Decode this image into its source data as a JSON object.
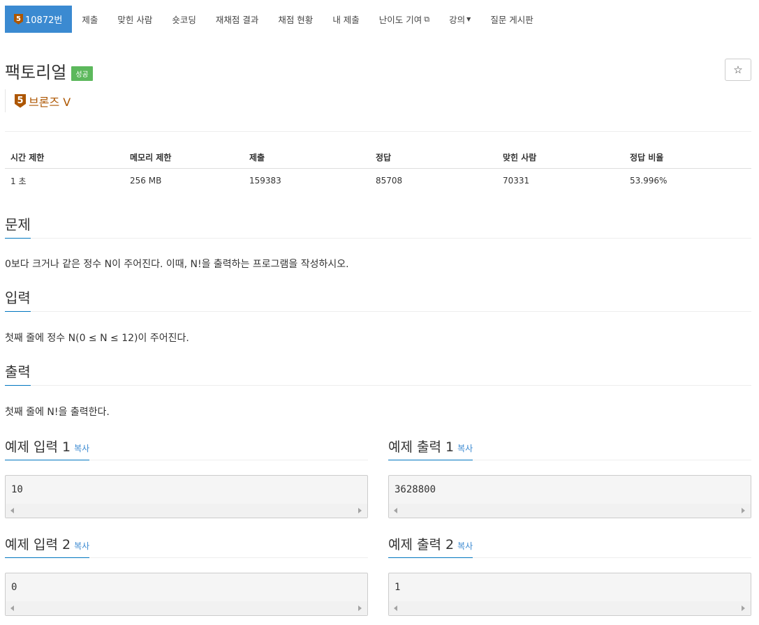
{
  "nav": {
    "problem_tab": "10872번",
    "tier_digit": "5",
    "items": [
      "제출",
      "맞힌 사람",
      "숏코딩",
      "재채점 결과",
      "채점 현황",
      "내 제출",
      "난이도 기여",
      "강의",
      "질문 게시판"
    ]
  },
  "problem": {
    "title": "팩토리얼",
    "status_label": "성공",
    "star_icon": "☆",
    "tier_digit": "5",
    "tier_name": "브론즈 V"
  },
  "info": {
    "headers": [
      "시간 제한",
      "메모리 제한",
      "제출",
      "정답",
      "맞힌 사람",
      "정답 비율"
    ],
    "values": [
      "1 초",
      "256 MB",
      "159383",
      "85708",
      "70331",
      "53.996%"
    ]
  },
  "sections": {
    "description_title": "문제",
    "description_text": "0보다 크거나 같은 정수 N이 주어진다. 이때, N!을 출력하는 프로그램을 작성하시오.",
    "input_title": "입력",
    "input_text": "첫째 줄에 정수 N(0 ≤ N ≤ 12)이 주어진다.",
    "output_title": "출력",
    "output_text": "첫째 줄에 N!을 출력한다."
  },
  "samples": [
    {
      "input_title": "예제 입력 1",
      "input_value": "10",
      "output_title": "예제 출력 1",
      "output_value": "3628800"
    },
    {
      "input_title": "예제 입력 2",
      "input_value": "0",
      "output_title": "예제 출력 2",
      "output_value": "1"
    }
  ],
  "copy_label": "복사",
  "colors": {
    "nav_active": "#3b8ad1",
    "bronze": "#ad5600",
    "success": "#5cb85c",
    "link": "#3b8ad1"
  }
}
